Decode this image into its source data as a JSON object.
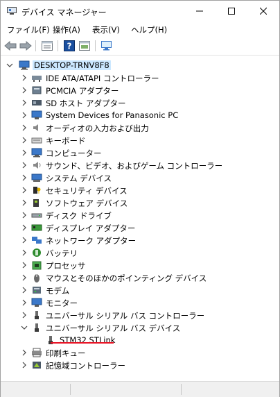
{
  "window": {
    "title": "デバイス マネージャー"
  },
  "menu": [
    "ファイル(F)",
    "操作(A)",
    "表示(V)",
    "ヘルプ(H)"
  ],
  "tree": {
    "root": "DESKTOP-TRNV8F8",
    "categories": [
      {
        "label": "IDE ATA/ATAPI コントローラー",
        "icon": "ide-controller-icon"
      },
      {
        "label": "PCMCIA アダプター",
        "icon": "pcmcia-icon"
      },
      {
        "label": "SD ホスト アダプター",
        "icon": "sd-host-icon"
      },
      {
        "label": "System Devices for Panasonic PC",
        "icon": "system-devices-icon"
      },
      {
        "label": "オーディオの入力および出力",
        "icon": "audio-icon"
      },
      {
        "label": "キーボード",
        "icon": "keyboard-icon"
      },
      {
        "label": "コンピューター",
        "icon": "computer-icon"
      },
      {
        "label": "サウンド、ビデオ、およびゲーム コントローラー",
        "icon": "sound-icon"
      },
      {
        "label": "システム デバイス",
        "icon": "system-icon"
      },
      {
        "label": "セキュリティ デバイス",
        "icon": "security-icon"
      },
      {
        "label": "ソフトウェア デバイス",
        "icon": "software-icon"
      },
      {
        "label": "ディスク ドライブ",
        "icon": "disk-icon"
      },
      {
        "label": "ディスプレイ アダプター",
        "icon": "display-icon"
      },
      {
        "label": "ネットワーク アダプター",
        "icon": "network-icon"
      },
      {
        "label": "バッテリ",
        "icon": "battery-icon"
      },
      {
        "label": "プロセッサ",
        "icon": "processor-icon"
      },
      {
        "label": "マウスとそのほかのポインティング デバイス",
        "icon": "mouse-icon"
      },
      {
        "label": "モデム",
        "icon": "modem-icon"
      },
      {
        "label": "モニター",
        "icon": "monitor-icon"
      },
      {
        "label": "ユニバーサル シリアル バス コントローラー",
        "icon": "usb-controller-icon"
      },
      {
        "label": "ユニバーサル シリアル バス デバイス",
        "icon": "usb-device-icon",
        "expanded": true
      },
      {
        "label": "STM32 STLink",
        "icon": "usb-plug-icon",
        "child": true,
        "highlighted": true
      },
      {
        "label": "印刷キュー",
        "icon": "print-queue-icon"
      },
      {
        "label": "記憶域コントローラー",
        "icon": "storage-controller-icon"
      }
    ]
  },
  "colors": {
    "selection": "#cce8ff",
    "highlight_underline": "#e81123",
    "toolbar_help_blue": "#1a4fa0"
  }
}
